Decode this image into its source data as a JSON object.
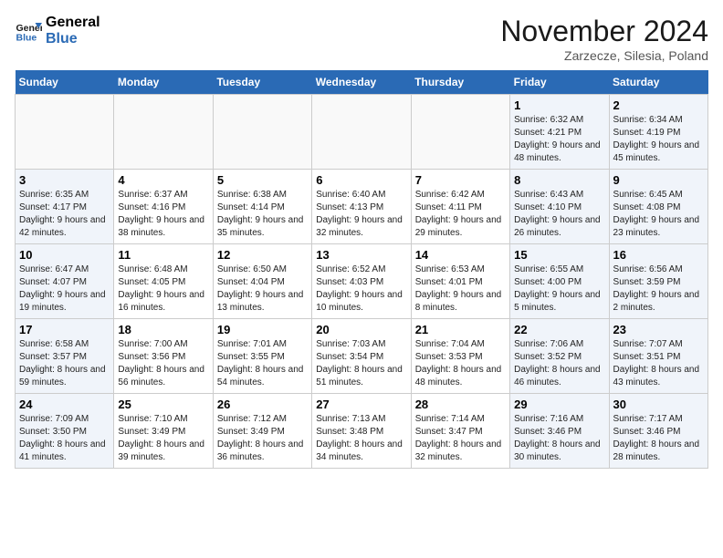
{
  "header": {
    "logo_line1": "General",
    "logo_line2": "Blue",
    "month": "November 2024",
    "location": "Zarzecze, Silesia, Poland"
  },
  "days_of_week": [
    "Sunday",
    "Monday",
    "Tuesday",
    "Wednesday",
    "Thursday",
    "Friday",
    "Saturday"
  ],
  "weeks": [
    [
      {
        "num": "",
        "info": "",
        "type": "empty"
      },
      {
        "num": "",
        "info": "",
        "type": "empty"
      },
      {
        "num": "",
        "info": "",
        "type": "empty"
      },
      {
        "num": "",
        "info": "",
        "type": "empty"
      },
      {
        "num": "",
        "info": "",
        "type": "empty"
      },
      {
        "num": "1",
        "info": "Sunrise: 6:32 AM\nSunset: 4:21 PM\nDaylight: 9 hours and 48 minutes.",
        "type": "weekend"
      },
      {
        "num": "2",
        "info": "Sunrise: 6:34 AM\nSunset: 4:19 PM\nDaylight: 9 hours and 45 minutes.",
        "type": "weekend"
      }
    ],
    [
      {
        "num": "3",
        "info": "Sunrise: 6:35 AM\nSunset: 4:17 PM\nDaylight: 9 hours and 42 minutes.",
        "type": "weekend"
      },
      {
        "num": "4",
        "info": "Sunrise: 6:37 AM\nSunset: 4:16 PM\nDaylight: 9 hours and 38 minutes.",
        "type": "weekday"
      },
      {
        "num": "5",
        "info": "Sunrise: 6:38 AM\nSunset: 4:14 PM\nDaylight: 9 hours and 35 minutes.",
        "type": "weekday"
      },
      {
        "num": "6",
        "info": "Sunrise: 6:40 AM\nSunset: 4:13 PM\nDaylight: 9 hours and 32 minutes.",
        "type": "weekday"
      },
      {
        "num": "7",
        "info": "Sunrise: 6:42 AM\nSunset: 4:11 PM\nDaylight: 9 hours and 29 minutes.",
        "type": "weekday"
      },
      {
        "num": "8",
        "info": "Sunrise: 6:43 AM\nSunset: 4:10 PM\nDaylight: 9 hours and 26 minutes.",
        "type": "weekend"
      },
      {
        "num": "9",
        "info": "Sunrise: 6:45 AM\nSunset: 4:08 PM\nDaylight: 9 hours and 23 minutes.",
        "type": "weekend"
      }
    ],
    [
      {
        "num": "10",
        "info": "Sunrise: 6:47 AM\nSunset: 4:07 PM\nDaylight: 9 hours and 19 minutes.",
        "type": "weekend"
      },
      {
        "num": "11",
        "info": "Sunrise: 6:48 AM\nSunset: 4:05 PM\nDaylight: 9 hours and 16 minutes.",
        "type": "weekday"
      },
      {
        "num": "12",
        "info": "Sunrise: 6:50 AM\nSunset: 4:04 PM\nDaylight: 9 hours and 13 minutes.",
        "type": "weekday"
      },
      {
        "num": "13",
        "info": "Sunrise: 6:52 AM\nSunset: 4:03 PM\nDaylight: 9 hours and 10 minutes.",
        "type": "weekday"
      },
      {
        "num": "14",
        "info": "Sunrise: 6:53 AM\nSunset: 4:01 PM\nDaylight: 9 hours and 8 minutes.",
        "type": "weekday"
      },
      {
        "num": "15",
        "info": "Sunrise: 6:55 AM\nSunset: 4:00 PM\nDaylight: 9 hours and 5 minutes.",
        "type": "weekend"
      },
      {
        "num": "16",
        "info": "Sunrise: 6:56 AM\nSunset: 3:59 PM\nDaylight: 9 hours and 2 minutes.",
        "type": "weekend"
      }
    ],
    [
      {
        "num": "17",
        "info": "Sunrise: 6:58 AM\nSunset: 3:57 PM\nDaylight: 8 hours and 59 minutes.",
        "type": "weekend"
      },
      {
        "num": "18",
        "info": "Sunrise: 7:00 AM\nSunset: 3:56 PM\nDaylight: 8 hours and 56 minutes.",
        "type": "weekday"
      },
      {
        "num": "19",
        "info": "Sunrise: 7:01 AM\nSunset: 3:55 PM\nDaylight: 8 hours and 54 minutes.",
        "type": "weekday"
      },
      {
        "num": "20",
        "info": "Sunrise: 7:03 AM\nSunset: 3:54 PM\nDaylight: 8 hours and 51 minutes.",
        "type": "weekday"
      },
      {
        "num": "21",
        "info": "Sunrise: 7:04 AM\nSunset: 3:53 PM\nDaylight: 8 hours and 48 minutes.",
        "type": "weekday"
      },
      {
        "num": "22",
        "info": "Sunrise: 7:06 AM\nSunset: 3:52 PM\nDaylight: 8 hours and 46 minutes.",
        "type": "weekend"
      },
      {
        "num": "23",
        "info": "Sunrise: 7:07 AM\nSunset: 3:51 PM\nDaylight: 8 hours and 43 minutes.",
        "type": "weekend"
      }
    ],
    [
      {
        "num": "24",
        "info": "Sunrise: 7:09 AM\nSunset: 3:50 PM\nDaylight: 8 hours and 41 minutes.",
        "type": "weekend"
      },
      {
        "num": "25",
        "info": "Sunrise: 7:10 AM\nSunset: 3:49 PM\nDaylight: 8 hours and 39 minutes.",
        "type": "weekday"
      },
      {
        "num": "26",
        "info": "Sunrise: 7:12 AM\nSunset: 3:49 PM\nDaylight: 8 hours and 36 minutes.",
        "type": "weekday"
      },
      {
        "num": "27",
        "info": "Sunrise: 7:13 AM\nSunset: 3:48 PM\nDaylight: 8 hours and 34 minutes.",
        "type": "weekday"
      },
      {
        "num": "28",
        "info": "Sunrise: 7:14 AM\nSunset: 3:47 PM\nDaylight: 8 hours and 32 minutes.",
        "type": "weekday"
      },
      {
        "num": "29",
        "info": "Sunrise: 7:16 AM\nSunset: 3:46 PM\nDaylight: 8 hours and 30 minutes.",
        "type": "weekend"
      },
      {
        "num": "30",
        "info": "Sunrise: 7:17 AM\nSunset: 3:46 PM\nDaylight: 8 hours and 28 minutes.",
        "type": "weekend"
      }
    ]
  ]
}
